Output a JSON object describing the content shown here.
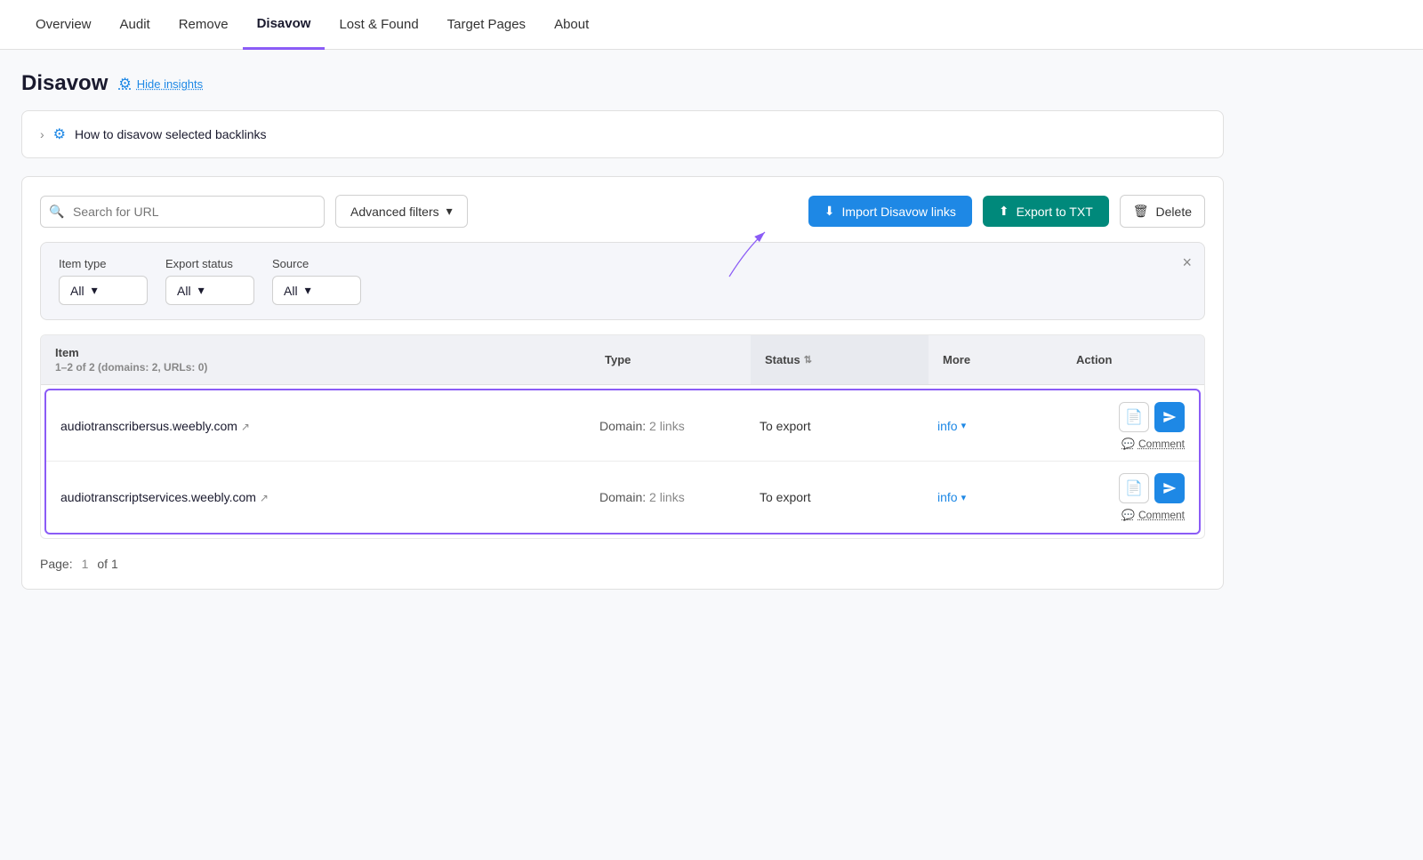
{
  "nav": {
    "items": [
      {
        "label": "Overview",
        "active": false
      },
      {
        "label": "Audit",
        "active": false
      },
      {
        "label": "Remove",
        "active": false
      },
      {
        "label": "Disavow",
        "active": true
      },
      {
        "label": "Lost & Found",
        "active": false
      },
      {
        "label": "Target Pages",
        "active": false
      },
      {
        "label": "About",
        "active": false
      }
    ]
  },
  "page": {
    "title": "Disavow",
    "hide_insights_label": "Hide insights",
    "info_box_text": "How to disavow selected backlinks"
  },
  "toolbar": {
    "search_placeholder": "Search for URL",
    "advanced_filters_label": "Advanced filters",
    "import_label": "Import Disavow links",
    "export_label": "Export to TXT",
    "delete_label": "Delete"
  },
  "filters": {
    "item_type_label": "Item type",
    "item_type_value": "All",
    "export_status_label": "Export status",
    "export_status_value": "All",
    "source_label": "Source",
    "source_value": "All"
  },
  "table": {
    "columns": [
      {
        "label": "Item",
        "key": "item"
      },
      {
        "label": "Type",
        "key": "type"
      },
      {
        "label": "Status",
        "key": "status",
        "sortable": true
      },
      {
        "label": "More",
        "key": "more"
      },
      {
        "label": "Action",
        "key": "action"
      }
    ],
    "item_count_label": "1–2 of 2 (domains: 2, URLs: 0)",
    "rows": [
      {
        "item": "audiotranscribersus.weebly.com",
        "type_prefix": "Domain:",
        "type_count": "2 links",
        "status": "To export",
        "info_label": "info",
        "comment_label": "Comment"
      },
      {
        "item": "audiotranscriptservices.weebly.com",
        "type_prefix": "Domain:",
        "type_count": "2 links",
        "status": "To export",
        "info_label": "info",
        "comment_label": "Comment"
      }
    ]
  },
  "pagination": {
    "page_label": "Page:",
    "current_page": "1",
    "of_label": "of 1"
  },
  "colors": {
    "accent_blue": "#1e88e5",
    "accent_teal": "#00897b",
    "accent_purple": "#8b5cf6",
    "nav_active_underline": "#8b5cf6"
  }
}
